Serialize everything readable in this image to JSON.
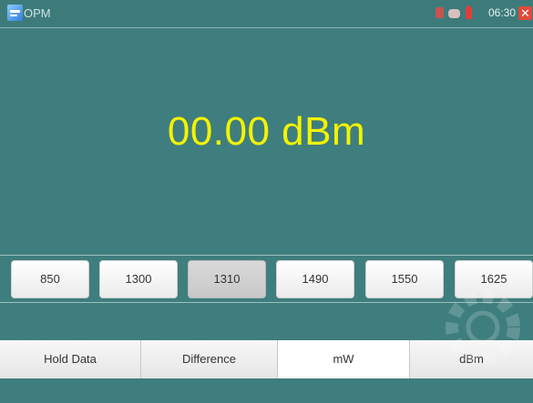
{
  "header": {
    "title": "OPM",
    "app_icon": "opm-app-icon",
    "status_icons": [
      "sd-card-icon",
      "usb-icon",
      "battery-icon"
    ],
    "time": "06:30",
    "close_icon": "close-icon",
    "accent_color": "#3f7e7e",
    "close_color": "#e04a3a"
  },
  "main": {
    "reading": "00.00 dBm",
    "reading_color": "#f3f300"
  },
  "wavelengths": [
    {
      "label": "850",
      "selected": false
    },
    {
      "label": "1300",
      "selected": false
    },
    {
      "label": "1310",
      "selected": true
    },
    {
      "label": "1490",
      "selected": false
    },
    {
      "label": "1550",
      "selected": false
    },
    {
      "label": "1625",
      "selected": false
    }
  ],
  "speaker": {
    "icon": "speaker-muted-icon"
  },
  "bottom_buttons": [
    {
      "label": "Hold Data",
      "selected": false
    },
    {
      "label": "Difference",
      "selected": false
    },
    {
      "label": "mW",
      "selected": true
    },
    {
      "label": "dBm",
      "selected": false
    }
  ]
}
